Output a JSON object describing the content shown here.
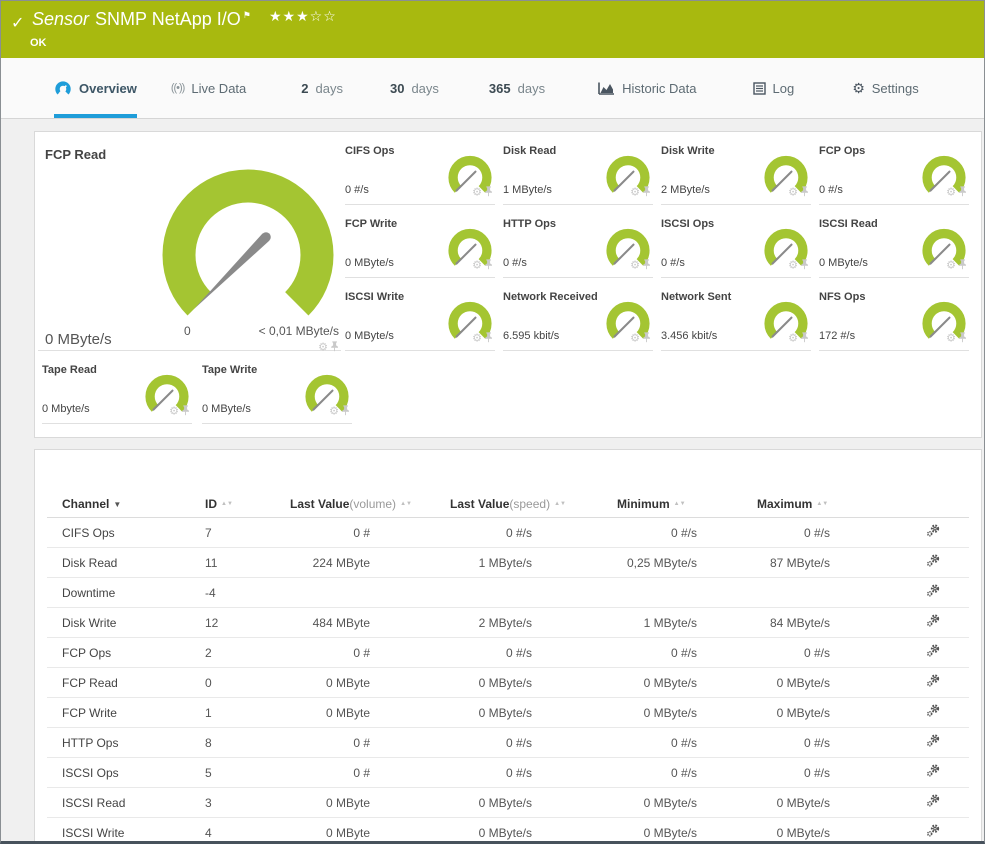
{
  "titlebar": {
    "kind": "Sensor",
    "title": "SNMP NetApp I/O",
    "status": "OK",
    "stars_filled": "★★★",
    "stars_empty": "☆☆"
  },
  "tabs": {
    "overview": "Overview",
    "live_data": "Live Data",
    "d2_num": "2",
    "d2_word": "days",
    "d30_num": "30",
    "d30_word": "days",
    "d365_num": "365",
    "d365_word": "days",
    "historic": "Historic Data",
    "log": "Log",
    "settings": "Settings",
    "live_glyph": "((•))"
  },
  "main_gauge": {
    "label": "FCP Read",
    "value": "0 MByte/s",
    "scale_min": "0",
    "scale_max": "< 0,01 MByte/s"
  },
  "small_gauges": [
    {
      "label": "CIFS Ops",
      "value": "0 #/s"
    },
    {
      "label": "Disk Read",
      "value": "1 MByte/s"
    },
    {
      "label": "Disk Write",
      "value": "2 MByte/s"
    },
    {
      "label": "FCP Ops",
      "value": "0 #/s"
    },
    {
      "label": "FCP Write",
      "value": "0 MByte/s"
    },
    {
      "label": "HTTP Ops",
      "value": "0 #/s"
    },
    {
      "label": "ISCSI Ops",
      "value": "0 #/s"
    },
    {
      "label": "ISCSI Read",
      "value": "0 MByte/s"
    },
    {
      "label": "ISCSI Write",
      "value": "0 MByte/s"
    },
    {
      "label": "Network Received",
      "value": "6.595 kbit/s"
    },
    {
      "label": "Network Sent",
      "value": "3.456 kbit/s"
    },
    {
      "label": "NFS Ops",
      "value": "172 #/s"
    }
  ],
  "tape_gauges": [
    {
      "label": "Tape Read",
      "value": "0 Mbyte/s"
    },
    {
      "label": "Tape Write",
      "value": "0 MByte/s"
    }
  ],
  "table": {
    "headers": {
      "channel": "Channel",
      "id": "ID",
      "last_volume": "Last Value",
      "last_volume_sub": "(volume)",
      "last_speed": "Last Value",
      "last_speed_sub": "(speed)",
      "minimum": "Minimum",
      "maximum": "Maximum"
    },
    "rows": [
      {
        "channel": "CIFS Ops",
        "id": "7",
        "vol": "0 #",
        "speed": "0 #/s",
        "min": "0 #/s",
        "max": "0 #/s"
      },
      {
        "channel": "Disk Read",
        "id": "11",
        "vol": "224 MByte",
        "speed": "1 MByte/s",
        "min": "0,25 MByte/s",
        "max": "87 MByte/s"
      },
      {
        "channel": "Downtime",
        "id": "-4",
        "vol": "",
        "speed": "",
        "min": "",
        "max": ""
      },
      {
        "channel": "Disk Write",
        "id": "12",
        "vol": "484 MByte",
        "speed": "2 MByte/s",
        "min": "1 MByte/s",
        "max": "84 MByte/s"
      },
      {
        "channel": "FCP Ops",
        "id": "2",
        "vol": "0 #",
        "speed": "0 #/s",
        "min": "0 #/s",
        "max": "0 #/s"
      },
      {
        "channel": "FCP Read",
        "id": "0",
        "vol": "0 MByte",
        "speed": "0 MByte/s",
        "min": "0 MByte/s",
        "max": "0 MByte/s"
      },
      {
        "channel": "FCP Write",
        "id": "1",
        "vol": "0 MByte",
        "speed": "0 MByte/s",
        "min": "0 MByte/s",
        "max": "0 MByte/s"
      },
      {
        "channel": "HTTP Ops",
        "id": "8",
        "vol": "0 #",
        "speed": "0 #/s",
        "min": "0 #/s",
        "max": "0 #/s"
      },
      {
        "channel": "ISCSI Ops",
        "id": "5",
        "vol": "0 #",
        "speed": "0 #/s",
        "min": "0 #/s",
        "max": "0 #/s"
      },
      {
        "channel": "ISCSI Read",
        "id": "3",
        "vol": "0 MByte",
        "speed": "0 MByte/s",
        "min": "0 MByte/s",
        "max": "0 MByte/s"
      },
      {
        "channel": "ISCSI Write",
        "id": "4",
        "vol": "0 MByte",
        "speed": "0 MByte/s",
        "min": "0 MByte/s",
        "max": "0 MByte/s"
      }
    ]
  },
  "colors": {
    "banner_green": "#a8b90f",
    "gauge_green": "#a4c532",
    "accent_blue": "#1f9dd9",
    "needle_gray": "#8a8a8a"
  }
}
